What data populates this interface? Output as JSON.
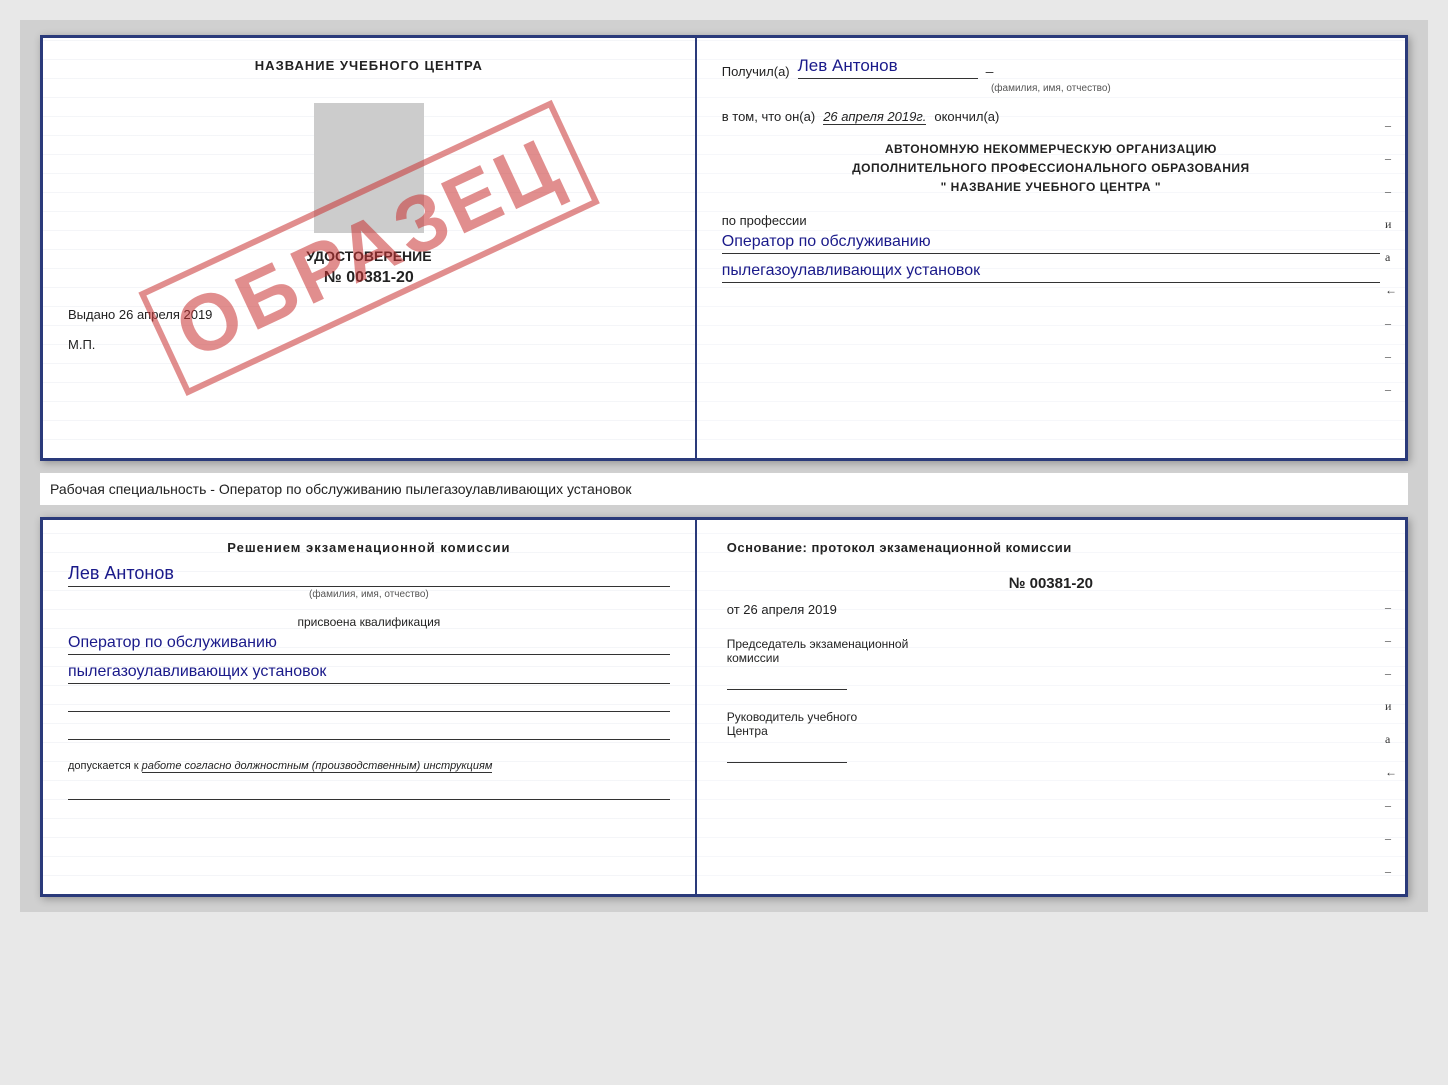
{
  "top_cert": {
    "left": {
      "school_title": "НАЗВАНИЕ УЧЕБНОГО ЦЕНТРА",
      "udostoverenie": "УДОСТОВЕРЕНИЕ",
      "number": "№ 00381-20",
      "vydano_label": "Выдано",
      "vydano_date": "26 апреля 2019",
      "mp": "М.П.",
      "watermark": "ОБРАЗЕЦ"
    },
    "right": {
      "poluchil": "Получил(а)",
      "name": "Лев Антонов",
      "fio_subtitle": "(фамилия, имя, отчество)",
      "vtom_prefix": "в том, что он(а)",
      "vtom_date": "26 апреля 2019г.",
      "okonchil": "окончил(а)",
      "org_line1": "АВТОНОМНУЮ НЕКОММЕРЧЕСКУЮ ОРГАНИЗАЦИЮ",
      "org_line2": "ДОПОЛНИТЕЛЬНОГО ПРОФЕССИОНАЛЬНОГО ОБРАЗОВАНИЯ",
      "org_quote_open": "\"",
      "org_name": "НАЗВАНИЕ УЧЕБНОГО ЦЕНТРА",
      "org_quote_close": "\"",
      "po_professii": "по профессии",
      "profession1": "Оператор по обслуживанию",
      "profession2": "пылегазоулавливающих установок"
    }
  },
  "middle_text": "Рабочая специальность - Оператор по обслуживанию пылегазоулавливающих установок",
  "bottom_cert": {
    "left": {
      "resheniem": "Решением экзаменационной комиссии",
      "name": "Лев Антонов",
      "fio_subtitle": "(фамилия, имя, отчество)",
      "prisvoena": "присвоена квалификация",
      "profession1": "Оператор по обслуживанию",
      "profession2": "пылегазоулавливающих установок",
      "dopuskaetsya_prefix": "допускается к",
      "dopuskaetsya_italic": "работе согласно должностным (производственным) инструкциям"
    },
    "right": {
      "osnovanie": "Основание: протокол экзаменационной комиссии",
      "number": "№ 00381-20",
      "ot_prefix": "от",
      "ot_date": "26 апреля 2019",
      "predsedatel_line1": "Председатель экзаменационной",
      "predsedatel_line2": "комиссии",
      "rukovoditel_line1": "Руководитель учебного",
      "rukovoditel_line2": "Центра"
    }
  },
  "dashes": {
    "side_chars": [
      "–",
      "–",
      "–",
      "и",
      "а",
      "←",
      "–",
      "–",
      "–"
    ]
  }
}
